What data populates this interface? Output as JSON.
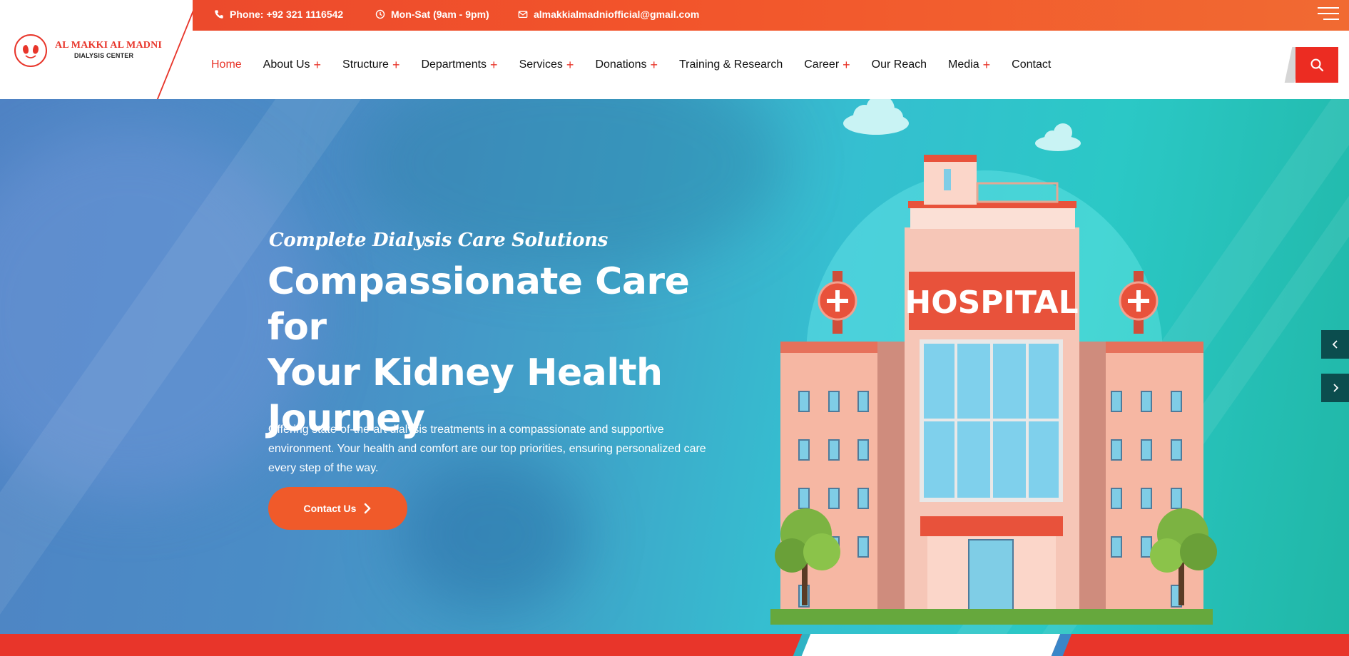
{
  "brand": {
    "name": "AL MAKKI AL MADNI",
    "subtitle": "DIALYSIS CENTER"
  },
  "topbar": {
    "phone": "Phone: +92 321 1116542",
    "hours": "Mon-Sat (9am - 9pm)",
    "email": "almakkialmadniofficial@gmail.com"
  },
  "nav": {
    "items": [
      {
        "label": "Home",
        "active": true,
        "has_submenu": false
      },
      {
        "label": "About Us",
        "has_submenu": true
      },
      {
        "label": "Structure",
        "has_submenu": true
      },
      {
        "label": "Departments",
        "has_submenu": true
      },
      {
        "label": "Services",
        "has_submenu": true
      },
      {
        "label": "Donations",
        "has_submenu": true
      },
      {
        "label": "Training & Research",
        "has_submenu": false
      },
      {
        "label": "Career",
        "has_submenu": true
      },
      {
        "label": "Our Reach",
        "has_submenu": false
      },
      {
        "label": "Media",
        "has_submenu": true
      },
      {
        "label": "Contact",
        "has_submenu": false
      }
    ],
    "submenu_marker": "+"
  },
  "hero": {
    "subtitle": "Complete Dialysis Care Solutions",
    "title_lines": [
      "Compassionate Care for",
      "Your Kidney Health",
      "Journey"
    ],
    "description": "Offering state-of-the-art dialysis treatments in a compassionate and supportive environment. Your health and comfort are our top priorities, ensuring personalized care every step of the way.",
    "button_label": "Contact Us",
    "illustration_sign": "HOSPITAL"
  },
  "icons": {
    "phone": "phone-icon",
    "clock": "clock-icon",
    "email": "envelope-icon",
    "menu": "hamburger-menu-icon",
    "search": "search-icon",
    "prev": "chevron-left-icon",
    "next": "chevron-right-icon"
  },
  "colors": {
    "accent": "#e8352a",
    "topbar": "#f2542b",
    "button": "#f05a2a",
    "slider_arrow": "#0b4d4e"
  }
}
